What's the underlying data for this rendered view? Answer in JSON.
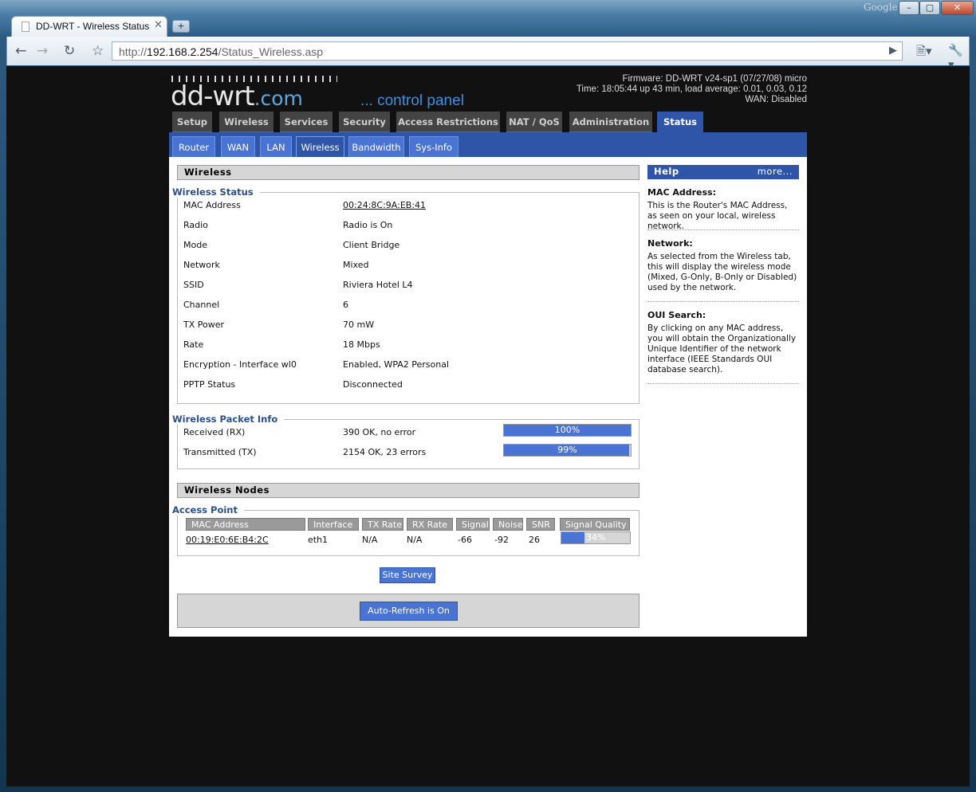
{
  "browser": {
    "brand_label": "Google",
    "tab_title": "DD-WRT - Wireless Status",
    "tab_close": "✕",
    "new_tab": "+",
    "url_scheme": "http://",
    "url_host": "192.168.2.254",
    "url_path": "/Status_Wireless.asp",
    "win_minimize": "–",
    "win_maximize": "▢",
    "win_close": "✕"
  },
  "header": {
    "logo_main": "dd-wrt",
    "logo_domain": ".com",
    "tagline": "... control panel",
    "firmware": "Firmware: DD-WRT v24-sp1 (07/27/08) micro",
    "time": "Time: 18:05:44 up 43 min, load average: 0.01, 0.03, 0.12",
    "wan": "WAN: Disabled"
  },
  "main_nav": [
    "Setup",
    "Wireless",
    "Services",
    "Security",
    "Access Restrictions",
    "NAT / QoS",
    "Administration",
    "Status"
  ],
  "sub_nav": [
    "Router",
    "WAN",
    "LAN",
    "Wireless",
    "Bandwidth",
    "Sys-Info"
  ],
  "wireless": {
    "heading": "Wireless",
    "status_legend": "Wireless Status",
    "rows": [
      {
        "label": "MAC Address",
        "value": "00:24:8C:9A:EB:41"
      },
      {
        "label": "Radio",
        "value": "Radio is On"
      },
      {
        "label": "Mode",
        "value": "Client Bridge"
      },
      {
        "label": "Network",
        "value": "Mixed"
      },
      {
        "label": "SSID",
        "value": "Riviera Hotel L4"
      },
      {
        "label": "Channel",
        "value": "6"
      },
      {
        "label": "TX Power",
        "value": "70 mW"
      },
      {
        "label": "Rate",
        "value": "18 Mbps"
      },
      {
        "label": "Encryption - Interface wl0",
        "value": "Enabled, WPA2 Personal"
      },
      {
        "label": "PPTP Status",
        "value": "Disconnected"
      }
    ]
  },
  "packet_info": {
    "legend": "Wireless Packet Info",
    "rows": [
      {
        "label": "Received (RX)",
        "value": "390 OK, no error",
        "percent_text": "100%",
        "fraction": 1.0
      },
      {
        "label": "Transmitted (TX)",
        "value": "2154 OK, 23 errors",
        "percent_text": "99%",
        "fraction": 0.99
      }
    ]
  },
  "nodes": {
    "heading": "Wireless Nodes",
    "ap_legend": "Access Point",
    "columns": [
      "MAC Address",
      "Interface",
      "TX Rate",
      "RX Rate",
      "Signal",
      "Noise",
      "SNR",
      "Signal Quality"
    ],
    "row": {
      "mac": "00:19:E0:6E:B4:2C",
      "interface": "eth1",
      "tx_rate": "N/A",
      "rx_rate": "N/A",
      "signal": "-66",
      "noise": "-92",
      "snr": "26",
      "quality_text": "34%",
      "quality_fraction": 0.34
    }
  },
  "buttons": {
    "site_survey": "Site Survey",
    "auto_refresh": "Auto-Refresh is On"
  },
  "help": {
    "heading": "Help",
    "more": "more...",
    "items": [
      {
        "title": "MAC Address:",
        "text": "This is the Router's MAC Address, as seen on your local, wireless network."
      },
      {
        "title": "Network:",
        "text": "As selected from the Wireless tab, this will display the wireless mode (Mixed, G-Only, B-Only or Disabled) used by the network."
      },
      {
        "title": "OUI Search:",
        "text": "By clicking on any MAC address, you will obtain the Organizationally Unique Identifier of the network interface (IEEE Standards OUI database search)."
      }
    ]
  },
  "colors": {
    "accent": "#2e55a8",
    "tab_blue": "#4a74d4",
    "page_bg": "#111111"
  }
}
